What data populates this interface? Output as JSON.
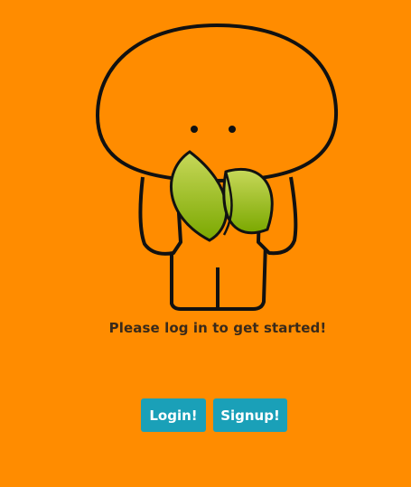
{
  "mascot": {
    "icon": "leaf-mascot-icon"
  },
  "main": {
    "prompt_text": "Please log in to get started!",
    "login_label": "Login!",
    "signup_label": "Signup!"
  },
  "colors": {
    "background": "#ff8c00",
    "button": "#1aa0b8",
    "button_text": "#ffffff",
    "leaf": "#8db82a"
  }
}
